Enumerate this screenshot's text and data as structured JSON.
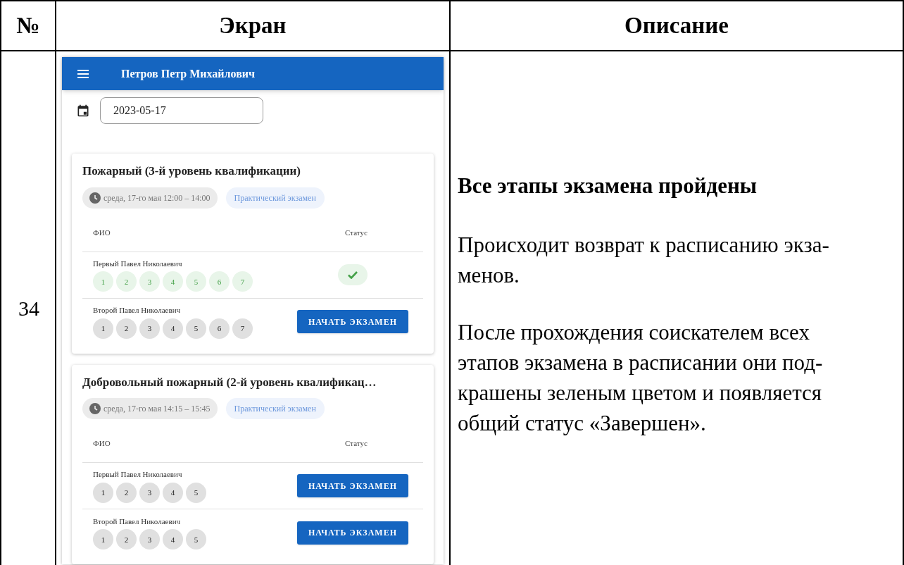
{
  "table": {
    "columns": [
      "№",
      "Экран",
      "Описание"
    ],
    "row": {
      "number": "34",
      "screen": {
        "app_bar": {
          "title": "Петров Петр Михайлович"
        },
        "date_field": {
          "value": "2023-05-17"
        },
        "exams": [
          {
            "title": "Пожарный (3-й уровень квалификации)",
            "time": "среда, 17-го мая 12:00 – 14:00",
            "type": "Практический экзамен",
            "col_name": "ФИО",
            "col_status": "Статус",
            "students": [
              {
                "name": "Первый Павел Николаевич",
                "stages": [
                  {
                    "label": "1",
                    "done": true
                  },
                  {
                    "label": "2",
                    "done": true
                  },
                  {
                    "label": "3",
                    "done": true
                  },
                  {
                    "label": "4",
                    "done": true
                  },
                  {
                    "label": "5",
                    "done": true
                  },
                  {
                    "label": "6",
                    "done": true
                  },
                  {
                    "label": "7",
                    "done": true
                  }
                ],
                "status": {
                  "kind": "done"
                }
              },
              {
                "name": "Второй Павел Николаевич",
                "stages": [
                  {
                    "label": "1",
                    "done": false
                  },
                  {
                    "label": "2",
                    "done": false
                  },
                  {
                    "label": "3",
                    "done": false
                  },
                  {
                    "label": "4",
                    "done": false
                  },
                  {
                    "label": "5",
                    "done": false
                  },
                  {
                    "label": "6",
                    "done": false
                  },
                  {
                    "label": "7",
                    "done": false
                  }
                ],
                "status": {
                  "kind": "button",
                  "label": "НАЧАТЬ ЭКЗАМЕН"
                }
              }
            ]
          },
          {
            "title": "Добровольный пожарный (2-й уровень квалификац…",
            "time": "среда, 17-го мая 14:15 – 15:45",
            "type": "Практический экзамен",
            "col_name": "ФИО",
            "col_status": "Статус",
            "students": [
              {
                "name": "Первый Павел Николаевич",
                "stages": [
                  {
                    "label": "1",
                    "done": false
                  },
                  {
                    "label": "2",
                    "done": false
                  },
                  {
                    "label": "3",
                    "done": false
                  },
                  {
                    "label": "4",
                    "done": false
                  },
                  {
                    "label": "5",
                    "done": false
                  }
                ],
                "status": {
                  "kind": "button",
                  "label": "НАЧАТЬ ЭКЗАМЕН"
                }
              },
              {
                "name": "Второй Павел Николаевич",
                "stages": [
                  {
                    "label": "1",
                    "done": false
                  },
                  {
                    "label": "2",
                    "done": false
                  },
                  {
                    "label": "3",
                    "done": false
                  },
                  {
                    "label": "4",
                    "done": false
                  },
                  {
                    "label": "5",
                    "done": false
                  }
                ],
                "status": {
                  "kind": "button",
                  "label": "НАЧАТЬ ЭКЗАМЕН"
                }
              }
            ]
          }
        ]
      },
      "description": {
        "heading": "Все этапы экзамена пройдены",
        "paragraphs": [
          "Происходит возврат к расписанию экза-\nменов.",
          "После прохождения соискателем всех\nэтапов экзамена в расписании они под-\nкрашены зеленым цветом и появляется\nобщий статус «Завершен»."
        ]
      }
    }
  }
}
